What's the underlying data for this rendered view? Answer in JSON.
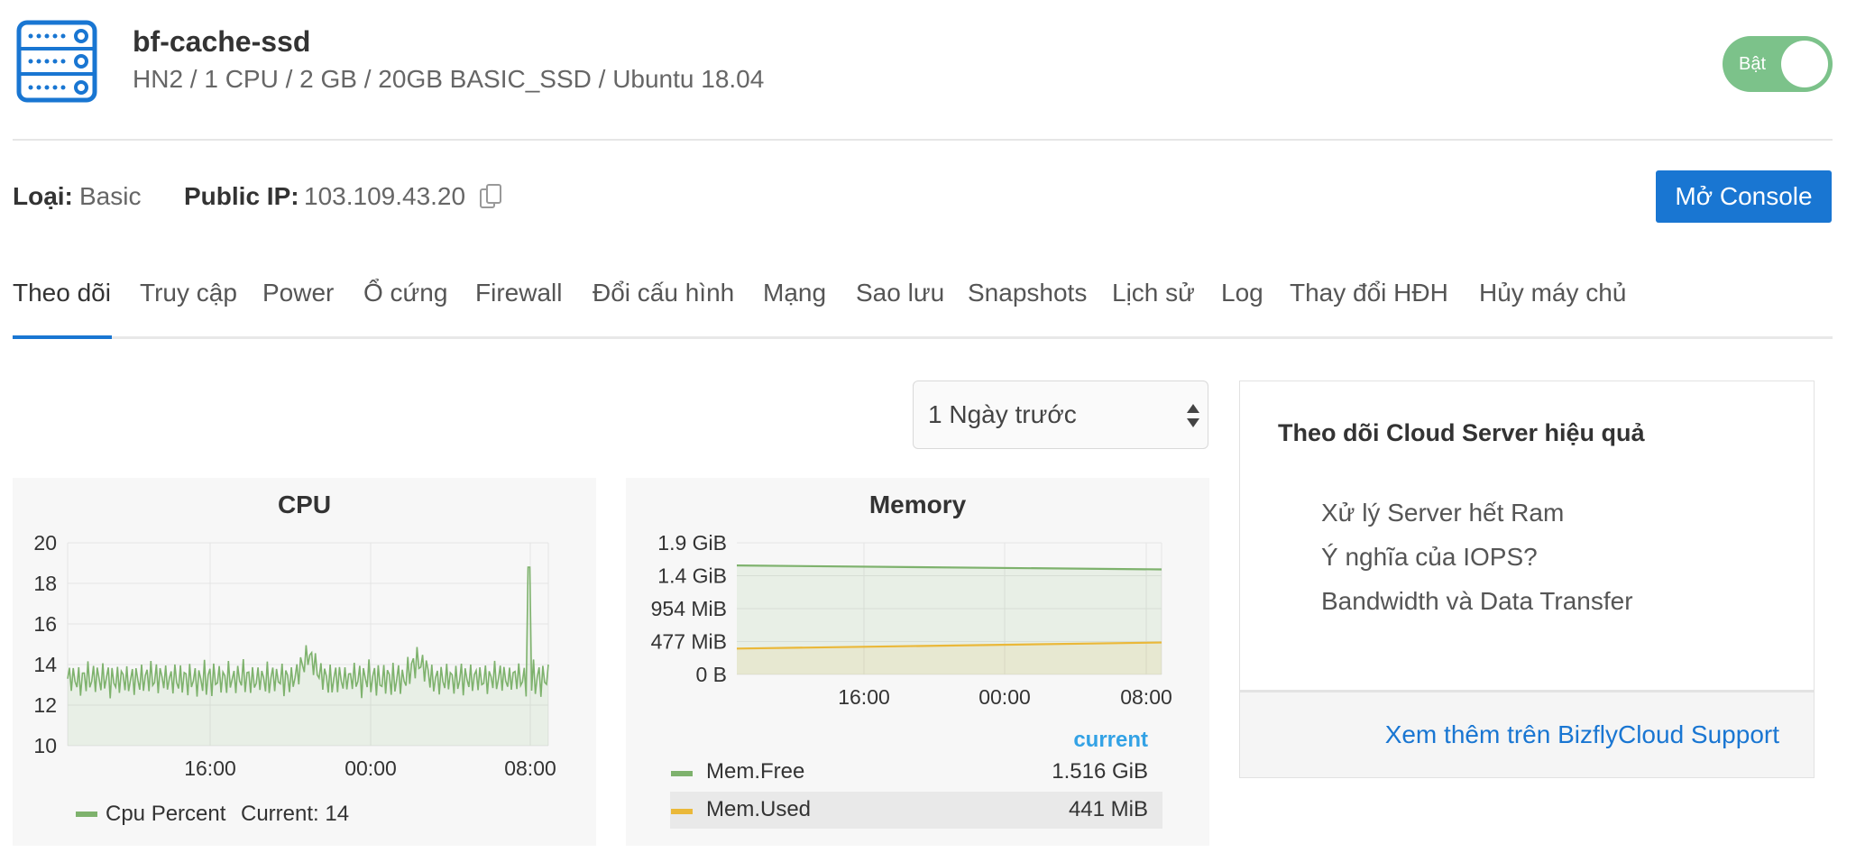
{
  "header": {
    "server_name": "bf-cache-ssd",
    "server_spec": "HN2 / 1 CPU / 2 GB / 20GB BASIC_SSD / Ubuntu 18.04",
    "icon": "server-icon",
    "power_toggle": {
      "label": "Bật",
      "state": "on",
      "color": "#7cc28a"
    }
  },
  "info": {
    "type_label": "Loại:",
    "type_value": "Basic",
    "ip_label": "Public IP:",
    "ip_value": "103.109.43.20",
    "copy_icon": "copy-icon",
    "console_button": "Mở Console"
  },
  "tabs": [
    {
      "label": "Theo dõi",
      "active": true
    },
    {
      "label": "Truy cập"
    },
    {
      "label": "Power"
    },
    {
      "label": "Ổ cứng"
    },
    {
      "label": "Firewall"
    },
    {
      "label": "Đổi cấu hình"
    },
    {
      "label": "Mạng"
    },
    {
      "label": "Sao lưu"
    },
    {
      "label": "Snapshots"
    },
    {
      "label": "Lịch sử"
    },
    {
      "label": "Log"
    },
    {
      "label": "Thay đổi HĐH"
    },
    {
      "label": "Hủy máy chủ"
    }
  ],
  "range_select": {
    "value": "1 Ngày trước"
  },
  "tips": {
    "title": "Theo dõi Cloud Server hiệu quả",
    "links": [
      "Xử lý Server hết Ram",
      "Ý nghĩa của IOPS?",
      "Bandwidth và Data Transfer"
    ],
    "support_link": "Xem thêm trên BizflyCloud Support"
  },
  "colors": {
    "accent": "#1976d2",
    "series_green": "#7eb26d",
    "series_yellow": "#eab839",
    "current_label": "#33a2e5"
  },
  "chart_data": [
    {
      "type": "line",
      "title": "CPU",
      "ylim": [
        10,
        20
      ],
      "yticks": [
        "20",
        "18",
        "16",
        "14",
        "12",
        "10"
      ],
      "xticks": [
        "16:00",
        "00:00",
        "08:00"
      ],
      "grid": true,
      "series": [
        {
          "name": "Cpu Percent",
          "color": "#7eb26d",
          "legend_text": "Current: 14",
          "base": 13.3,
          "amplitude": 1.0,
          "bumps": [
            {
              "at": 0.5,
              "height": 1.5
            },
            {
              "at": 0.73,
              "height": 1.2
            },
            {
              "at": 0.96,
              "height": 5.5
            }
          ],
          "last": 14
        }
      ]
    },
    {
      "type": "line",
      "title": "Memory",
      "yticks": [
        "1.9 GiB",
        "1.4 GiB",
        "954 MiB",
        "477 MiB",
        "0 B"
      ],
      "ylim_mib": [
        0,
        1945
      ],
      "xticks": [
        "16:00",
        "00:00",
        "08:00"
      ],
      "grid": true,
      "legend_header": "current",
      "series": [
        {
          "name": "Mem.Free",
          "color": "#7eb26d",
          "current": "1.516 GiB",
          "start_mib": 1610,
          "end_mib": 1552
        },
        {
          "name": "Mem.Used",
          "color": "#eab839",
          "current": "441 MiB",
          "start_mib": 382,
          "end_mib": 472
        }
      ]
    }
  ]
}
